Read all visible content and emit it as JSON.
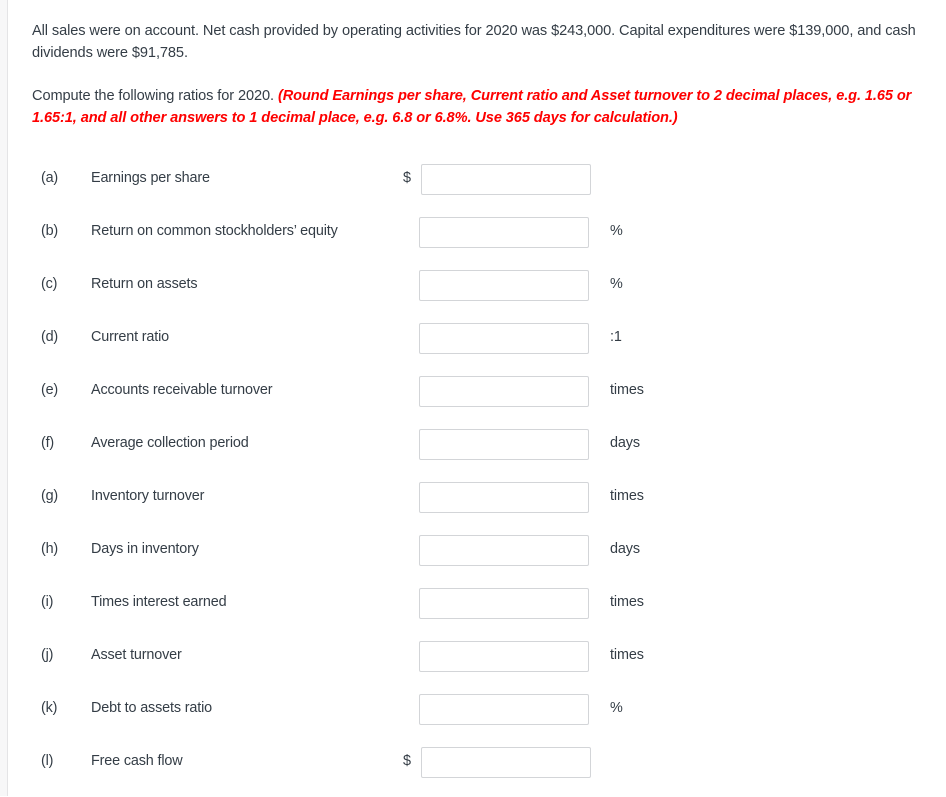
{
  "document": {
    "paragraph_1": "All sales were on account. Net cash provided by operating activities for 2020 was $243,000. Capital expenditures were $139,000, and cash dividends were $91,785.",
    "paragraph_2_lead": "Compute the following ratios for 2020. ",
    "paragraph_2_instruction": "(Round Earnings per share, Current ratio and Asset turnover to 2 decimal places, e.g. 1.65 or 1.65:1, and all other answers to 1 decimal place, e.g. 6.8 or 6.8%. Use 365 days for calculation.)",
    "instruction_color": "#fe0000",
    "body_color": "#343d46"
  },
  "ratios": [
    {
      "letter": "(a)",
      "label": "Earnings per share",
      "prefix": "$",
      "suffix": "",
      "value": "",
      "placeholder": ""
    },
    {
      "letter": "(b)",
      "label": "Return on common stockholders’ equity",
      "prefix": "",
      "suffix": "%",
      "value": "",
      "placeholder": ""
    },
    {
      "letter": "(c)",
      "label": "Return on assets",
      "prefix": "",
      "suffix": "%",
      "value": "",
      "placeholder": ""
    },
    {
      "letter": "(d)",
      "label": "Current ratio",
      "prefix": "",
      "suffix": ":1",
      "value": "",
      "placeholder": ""
    },
    {
      "letter": "(e)",
      "label": "Accounts receivable turnover",
      "prefix": "",
      "suffix": "times",
      "value": "",
      "placeholder": ""
    },
    {
      "letter": "(f)",
      "label": "Average collection period",
      "prefix": "",
      "suffix": "days",
      "value": "",
      "placeholder": ""
    },
    {
      "letter": "(g)",
      "label": "Inventory turnover",
      "prefix": "",
      "suffix": "times",
      "value": "",
      "placeholder": ""
    },
    {
      "letter": "(h)",
      "label": "Days in inventory",
      "prefix": "",
      "suffix": "days",
      "value": "",
      "placeholder": ""
    },
    {
      "letter": "(i)",
      "label": "Times interest earned",
      "prefix": "",
      "suffix": "times",
      "value": "",
      "placeholder": ""
    },
    {
      "letter": "(j)",
      "label": "Asset turnover",
      "prefix": "",
      "suffix": "times",
      "value": "",
      "placeholder": ""
    },
    {
      "letter": "(k)",
      "label": "Debt to assets ratio",
      "prefix": "",
      "suffix": "%",
      "value": "",
      "placeholder": ""
    },
    {
      "letter": "(l)",
      "label": "Free cash flow",
      "prefix": "$",
      "suffix": "",
      "value": "",
      "placeholder": ""
    }
  ]
}
